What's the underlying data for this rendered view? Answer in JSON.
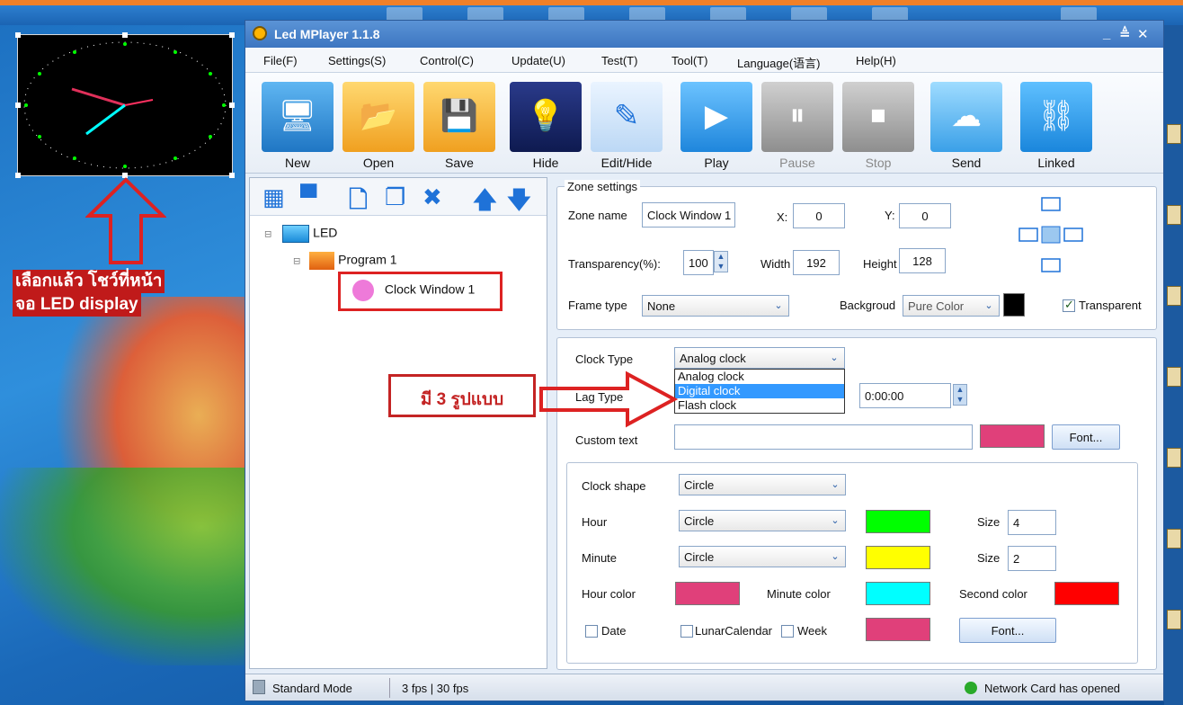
{
  "window": {
    "title": "Led MPlayer 1.1.8",
    "controls": [
      "_",
      "≜",
      "✕"
    ]
  },
  "menu": [
    "File(F)",
    "Settings(S)",
    "Control(C)",
    "Update(U)",
    "Test(T)",
    "Tool(T)",
    "Language(语言)",
    "Help(H)"
  ],
  "toolbar": [
    {
      "label": "New",
      "icon": "monitor-icon",
      "enabled": true
    },
    {
      "label": "Open",
      "icon": "folder-icon",
      "enabled": true
    },
    {
      "label": "Save",
      "icon": "floppy-icon",
      "enabled": true
    },
    {
      "label": "Hide",
      "icon": "lightbulb-icon",
      "enabled": true
    },
    {
      "label": "Edit/Hide",
      "icon": "pencil-icon",
      "enabled": true
    },
    {
      "label": "Play",
      "icon": "play-icon",
      "enabled": true
    },
    {
      "label": "Pause",
      "icon": "pause-icon",
      "enabled": false
    },
    {
      "label": "Stop",
      "icon": "stop-icon",
      "enabled": false
    },
    {
      "label": "Send",
      "icon": "cloud-send-icon",
      "enabled": true
    },
    {
      "label": "Linked",
      "icon": "link-icon",
      "enabled": true
    }
  ],
  "tree": {
    "root": "LED",
    "program": "Program 1",
    "window": "Clock Window 1"
  },
  "zone": {
    "legend": "Zone settings",
    "zone_name_label": "Zone name",
    "zone_name": "Clock Window 1",
    "x_label": "X:",
    "x": "0",
    "y_label": "Y:",
    "y": "0",
    "transparency_label": "Transparency(%):",
    "transparency": "100",
    "width_label": "Width",
    "width": "192",
    "height_label": "Height",
    "height": "128",
    "frame_type_label": "Frame type",
    "frame_type": "None",
    "background_label": "Backgroud",
    "background": "Pure Color",
    "transparent_label": "Transparent"
  },
  "clock": {
    "type_label": "Clock Type",
    "type": "Analog clock",
    "type_options": [
      "Analog clock",
      "Digital clock",
      "Flash clock"
    ],
    "lag_label": "Lag Type",
    "lag_time": "0:00:00",
    "custom_text_label": "Custom text",
    "custom_text": "",
    "font_button": "Font...",
    "shape_label": "Clock shape",
    "shape": "Circle",
    "hour_label": "Hour",
    "hour_shape": "Circle",
    "hour_size_label": "Size",
    "hour_size": "4",
    "minute_label": "Minute",
    "minute_shape": "Circle",
    "minute_size_label": "Size",
    "minute_size": "2",
    "hour_color_label": "Hour color",
    "minute_color_label": "Minute color",
    "second_color_label": "Second color",
    "date_label": "Date",
    "lunar_label": "LunarCalendar",
    "week_label": "Week",
    "font_button2": "Font..."
  },
  "colors": {
    "custom_text": "#e0407a",
    "hour_marker": "#00ff00",
    "minute_marker": "#ffff00",
    "hour_color": "#e0407a",
    "minute_color": "#00ffff",
    "second_color": "#ff0000",
    "date_color": "#e0407a",
    "background": "#000000"
  },
  "status": {
    "mode": "Standard Mode",
    "fps": "3 fps | 30 fps",
    "network": "Network Card has opened"
  },
  "annotations": {
    "left": [
      "เลือกแล้ว โชว์ที่หน้า",
      "จอ LED display"
    ],
    "center": "มี 3 รูปแบบ"
  }
}
